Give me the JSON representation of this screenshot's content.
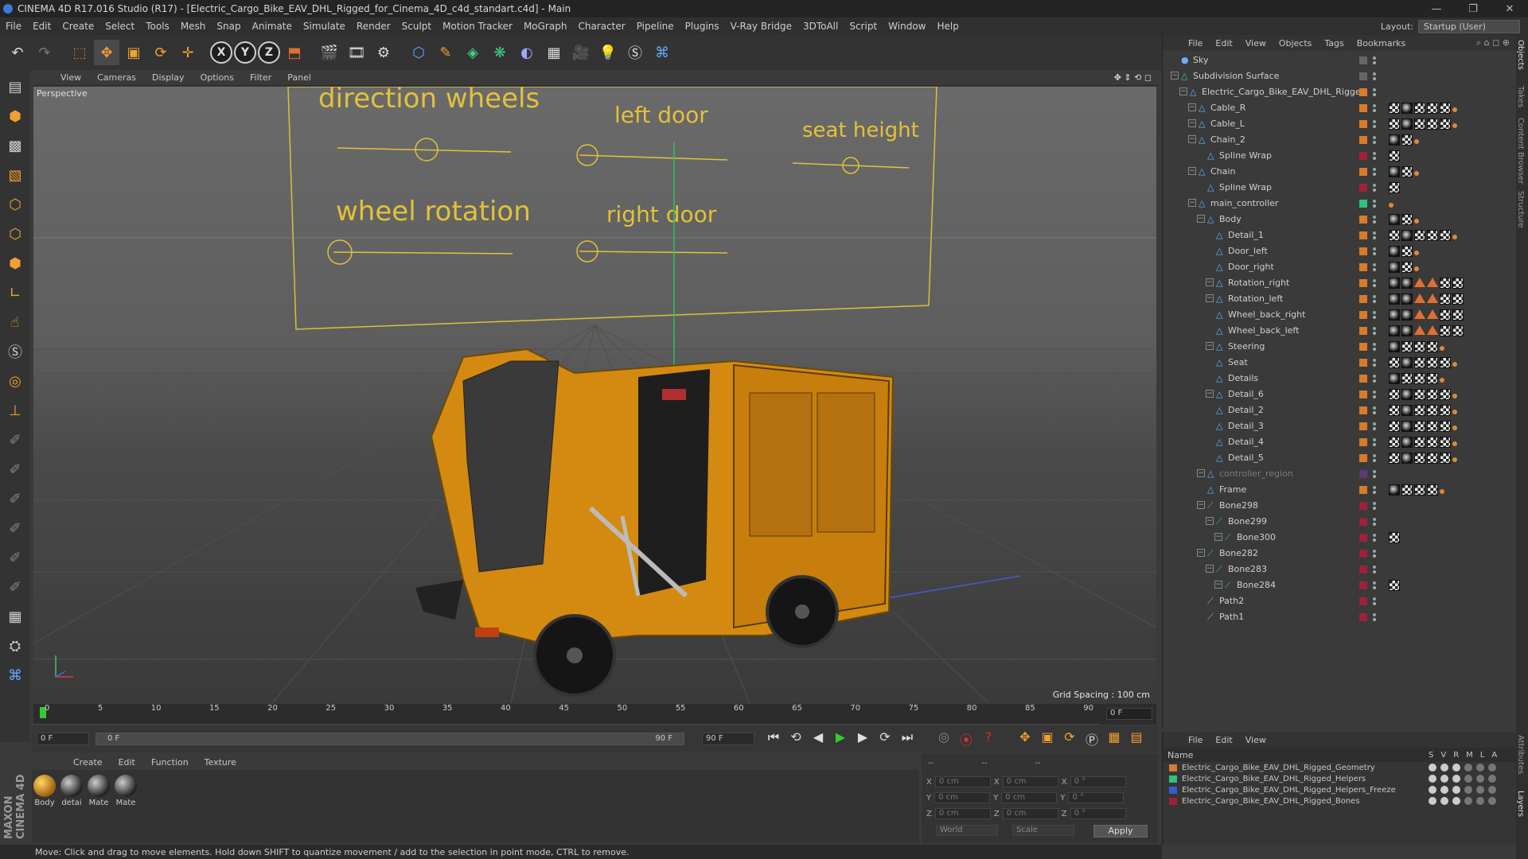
{
  "window": {
    "title": "CINEMA 4D R17.016 Studio (R17) - [Electric_Cargo_Bike_EAV_DHL_Rigged_for_Cinema_4D_c4d_standart.c4d] - Main",
    "minimize": "—",
    "restore": "❐",
    "close": "✕"
  },
  "menubar": {
    "items": [
      "File",
      "Edit",
      "Create",
      "Select",
      "Tools",
      "Mesh",
      "Snap",
      "Animate",
      "Simulate",
      "Render",
      "Sculpt",
      "Motion Tracker",
      "MoGraph",
      "Character",
      "Pipeline",
      "Plugins",
      "V-Ray Bridge",
      "3DToAll",
      "Script",
      "Window",
      "Help"
    ],
    "layout_label": "Layout:",
    "layout_value": "Startup (User)"
  },
  "toolbar": {
    "icons": [
      "undo-icon",
      "redo-icon",
      "live-select-icon",
      "move-icon",
      "scale-icon",
      "rotate-icon",
      "add-object-icon",
      "x-axis-icon",
      "y-axis-icon",
      "z-axis-icon",
      "coordinate-system-icon",
      "render-view-icon",
      "render-picture-viewer-icon",
      "edit-render-settings-icon",
      "cube-icon",
      "pen-spline-icon",
      "subdivision-icon",
      "array-icon",
      "deformer-icon",
      "floor-icon",
      "camera-icon",
      "light-icon",
      "scene-sync-icon",
      "python-icon"
    ],
    "axis_x": "X",
    "axis_y": "Y",
    "axis_z": "Z"
  },
  "left_tools": [
    "make-editable-icon",
    "model-mode-icon",
    "texture-mode-icon",
    "workplane-icon",
    "points-mode-icon",
    "edges-mode-icon",
    "polygons-mode-icon",
    "axis-mode-icon",
    "tweak-icon",
    "solo-icon",
    "magnet-icon",
    "snap-icon",
    "brush-icon",
    "brush-icon",
    "brush-icon",
    "brush-icon",
    "brush-icon",
    "brush-icon",
    "brush-icon",
    "grid-icon",
    "lock-icon",
    "python-icon"
  ],
  "branding": "MAXON CINEMA 4D",
  "viewport": {
    "menu": [
      "View",
      "Cameras",
      "Display",
      "Options",
      "Filter",
      "Panel"
    ],
    "camera_label": "Perspective",
    "grid_spacing": "Grid Spacing : 100 cm",
    "controller_labels": [
      "direction wheels",
      "left door",
      "seat height",
      "wheel rotation",
      "right door"
    ]
  },
  "timeline": {
    "ticks": [
      "0",
      "5",
      "10",
      "15",
      "20",
      "25",
      "30",
      "35",
      "40",
      "45",
      "50",
      "55",
      "60",
      "65",
      "70",
      "75",
      "80",
      "85",
      "90"
    ],
    "current_frame": "0 F"
  },
  "transport": {
    "start_field": "0 F",
    "range_start": "0 F",
    "range_end": "90 F",
    "end_field": "90 F"
  },
  "material_panel": {
    "menu": [
      "Create",
      "Edit",
      "Function",
      "Texture"
    ],
    "materials": [
      "Body",
      "detai",
      "Mate",
      "Mate"
    ]
  },
  "coordinates": {
    "header": [
      "--",
      "--",
      "--"
    ],
    "rows": [
      {
        "a": "X",
        "a_val": "0 cm",
        "b": "X",
        "b_val": "0 cm",
        "c": "X",
        "c_val": "0 °"
      },
      {
        "a": "Y",
        "a_val": "0 cm",
        "b": "Y",
        "b_val": "0 cm",
        "c": "Y",
        "c_val": "0 °"
      },
      {
        "a": "Z",
        "a_val": "0 cm",
        "b": "Z",
        "b_val": "0 cm",
        "c": "Z",
        "c_val": "0 °"
      }
    ],
    "mode": "World",
    "size_mode": "Scale",
    "apply": "Apply"
  },
  "status": "Move: Click and drag to move elements. Hold down SHIFT to quantize movement / add to the selection in point mode, CTRL to remove.",
  "objects_panel": {
    "menu": [
      "File",
      "Edit",
      "View",
      "Objects",
      "Tags",
      "Bookmarks"
    ],
    "objects": [
      {
        "name": "Sky",
        "depth": 0,
        "expand": false,
        "color": "#666666",
        "tags": ""
      },
      {
        "name": "Subdivision Surface",
        "depth": 0,
        "expand": true,
        "color": "#666666",
        "tags": ""
      },
      {
        "name": "Electric_Cargo_Bike_EAV_DHL_Rigged",
        "depth": 1,
        "expand": true,
        "color": "#d97a2c",
        "tags": ""
      },
      {
        "name": "Cable_R",
        "depth": 2,
        "expand": true,
        "color": "#d97a2c",
        "tags": "cmccco"
      },
      {
        "name": "Cable_L",
        "depth": 2,
        "expand": true,
        "color": "#d97a2c",
        "tags": "cmccco"
      },
      {
        "name": "Chain_2",
        "depth": 2,
        "expand": true,
        "color": "#d97a2c",
        "tags": "mco"
      },
      {
        "name": "Spline Wrap",
        "depth": 3,
        "expand": false,
        "color": "#a0203a",
        "tags": "c"
      },
      {
        "name": "Chain",
        "depth": 2,
        "expand": true,
        "color": "#d97a2c",
        "tags": "mco"
      },
      {
        "name": "Spline Wrap",
        "depth": 3,
        "expand": false,
        "color": "#a0203a",
        "tags": "c"
      },
      {
        "name": "main_controller",
        "depth": 2,
        "expand": true,
        "color": "#2ec27e",
        "tags": "o"
      },
      {
        "name": "Body",
        "depth": 3,
        "expand": true,
        "color": "#d97a2c",
        "tags": "mco"
      },
      {
        "name": "Detail_1",
        "depth": 4,
        "expand": false,
        "color": "#d97a2c",
        "tags": "cmccco"
      },
      {
        "name": "Door_left",
        "depth": 4,
        "expand": false,
        "color": "#d97a2c",
        "tags": "mco"
      },
      {
        "name": "Door_right",
        "depth": 4,
        "expand": false,
        "color": "#d97a2c",
        "tags": "mco"
      },
      {
        "name": "Rotation_right",
        "depth": 4,
        "expand": true,
        "color": "#d97a2c",
        "tags": "mmttcc"
      },
      {
        "name": "Rotation_left",
        "depth": 4,
        "expand": true,
        "color": "#d97a2c",
        "tags": "mmttcc"
      },
      {
        "name": "Wheel_back_right",
        "depth": 4,
        "expand": false,
        "color": "#d97a2c",
        "tags": "mmttcc"
      },
      {
        "name": "Wheel_back_left",
        "depth": 4,
        "expand": false,
        "color": "#d97a2c",
        "tags": "mmttcc"
      },
      {
        "name": "Steering",
        "depth": 4,
        "expand": true,
        "color": "#d97a2c",
        "tags": "mccco"
      },
      {
        "name": "Seat",
        "depth": 4,
        "expand": false,
        "color": "#d97a2c",
        "tags": "cmccco"
      },
      {
        "name": "Details",
        "depth": 4,
        "expand": false,
        "color": "#d97a2c",
        "tags": "mccco"
      },
      {
        "name": "Detail_6",
        "depth": 4,
        "expand": true,
        "color": "#d97a2c",
        "tags": "cmccco"
      },
      {
        "name": "Detail_2",
        "depth": 4,
        "expand": false,
        "color": "#d97a2c",
        "tags": "cmccco"
      },
      {
        "name": "Detail_3",
        "depth": 4,
        "expand": false,
        "color": "#d97a2c",
        "tags": "cmccco"
      },
      {
        "name": "Detail_4",
        "depth": 4,
        "expand": false,
        "color": "#d97a2c",
        "tags": "cmccco"
      },
      {
        "name": "Detail_5",
        "depth": 4,
        "expand": false,
        "color": "#d97a2c",
        "tags": "cmccco"
      },
      {
        "name": "controller_region",
        "depth": 3,
        "expand": true,
        "color": "#5a3a7a",
        "tags": "",
        "dim": true
      },
      {
        "name": "Frame",
        "depth": 3,
        "expand": false,
        "color": "#d97a2c",
        "tags": "mccco"
      },
      {
        "name": "Bone298",
        "depth": 3,
        "expand": true,
        "color": "#a0203a",
        "tags": ""
      },
      {
        "name": "Bone299",
        "depth": 4,
        "expand": true,
        "color": "#a0203a",
        "tags": ""
      },
      {
        "name": "Bone300",
        "depth": 5,
        "expand": true,
        "color": "#a0203a",
        "tags": "c"
      },
      {
        "name": "Bone282",
        "depth": 3,
        "expand": true,
        "color": "#a0203a",
        "tags": ""
      },
      {
        "name": "Bone283",
        "depth": 4,
        "expand": true,
        "color": "#a0203a",
        "tags": ""
      },
      {
        "name": "Bone284",
        "depth": 5,
        "expand": true,
        "color": "#a0203a",
        "tags": "c"
      },
      {
        "name": "Path2",
        "depth": 3,
        "expand": false,
        "color": "#a0203a",
        "tags": ""
      },
      {
        "name": "Path1",
        "depth": 3,
        "expand": false,
        "color": "#a0203a",
        "tags": ""
      }
    ]
  },
  "layers_panel": {
    "menu": [
      "File",
      "Edit",
      "View"
    ],
    "header_name": "Name",
    "header_cols": [
      "S",
      "V",
      "R",
      "M",
      "L",
      "A"
    ],
    "layers": [
      {
        "name": "Electric_Cargo_Bike_EAV_DHL_Rigged_Geometry",
        "color": "#d97a2c"
      },
      {
        "name": "Electric_Cargo_Bike_EAV_DHL_Rigged_Helpers",
        "color": "#2ec27e"
      },
      {
        "name": "Electric_Cargo_Bike_EAV_DHL_Rigged_Helpers_Freeze",
        "color": "#3a5ad0"
      },
      {
        "name": "Electric_Cargo_Bike_EAV_DHL_Rigged_Bones",
        "color": "#a0203a"
      }
    ]
  },
  "right_strip_tabs": [
    "Objects",
    "Takes",
    "Content Browser",
    "Structure",
    "Attributes",
    "Layers"
  ]
}
